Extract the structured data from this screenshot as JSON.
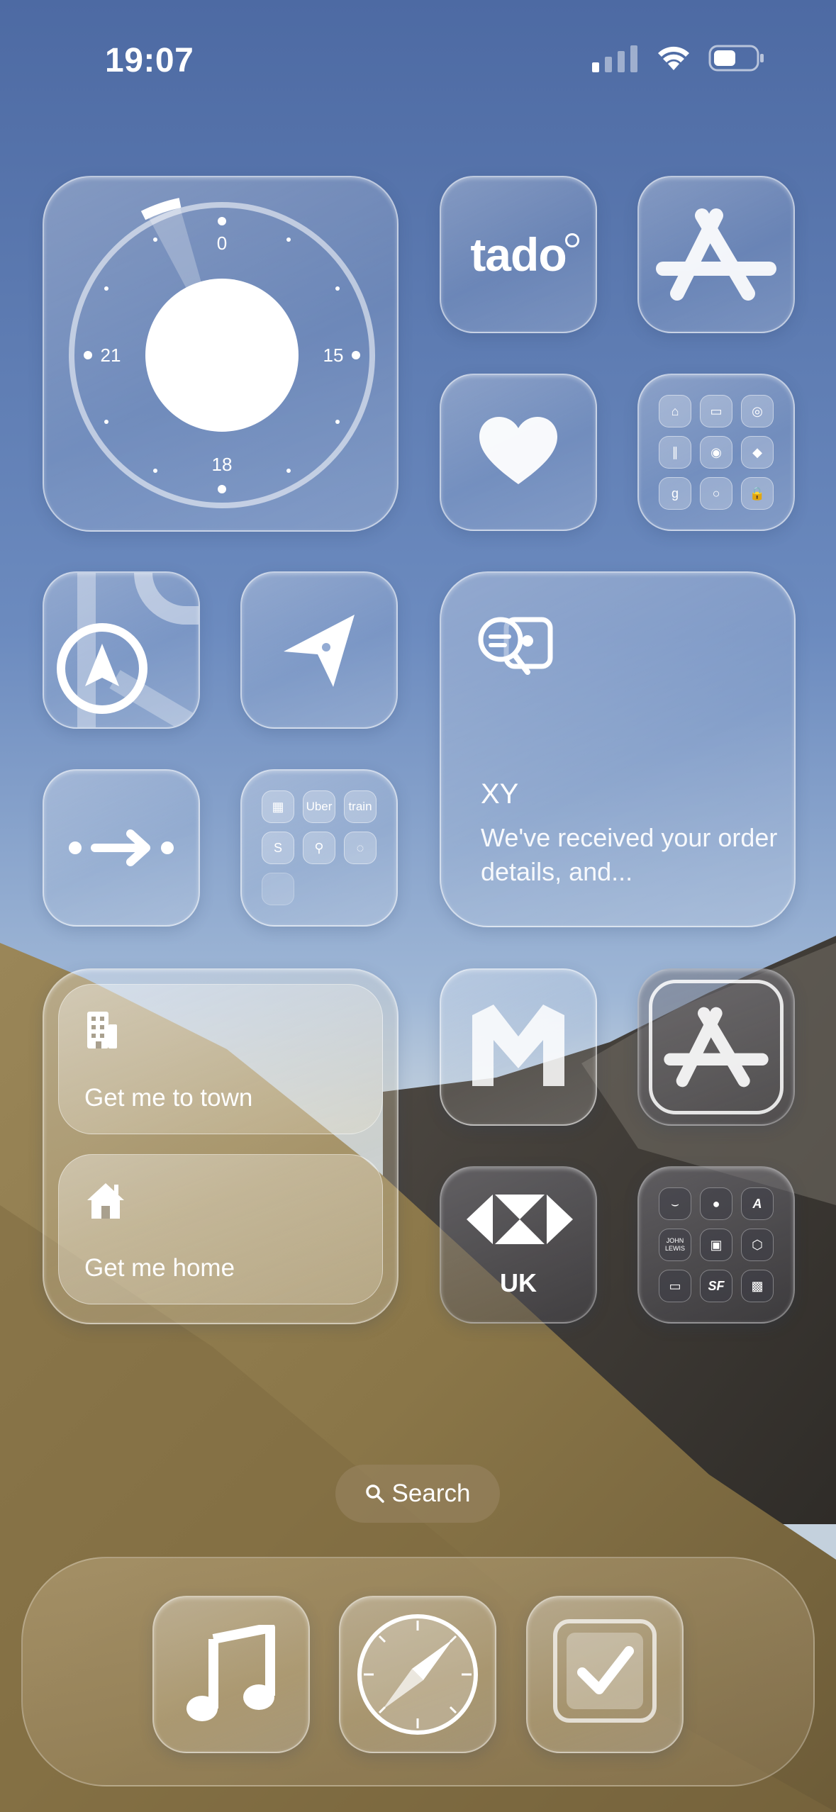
{
  "status_bar": {
    "time": "19:07"
  },
  "clock_widget": {
    "labels": {
      "top": "0",
      "right": "15",
      "bottom": "18",
      "left": "21"
    }
  },
  "apps": {
    "tado": "tado",
    "hsbc": "UK"
  },
  "folder_utilities": {
    "train_label": "train",
    "uber_label": "Uber"
  },
  "folder_shopping": {
    "jl_label": "JOHN LEWIS"
  },
  "notification_widget": {
    "title": "XY",
    "body": "We've received your order details, and..."
  },
  "shortcuts_widget": {
    "items": [
      {
        "label": "Get me to town",
        "icon": "building-icon"
      },
      {
        "label": "Get me home",
        "icon": "house-icon"
      }
    ]
  },
  "search": {
    "label": "Search"
  },
  "colors": {
    "sky": "#5a76ab",
    "accent_white": "#ffffff"
  }
}
